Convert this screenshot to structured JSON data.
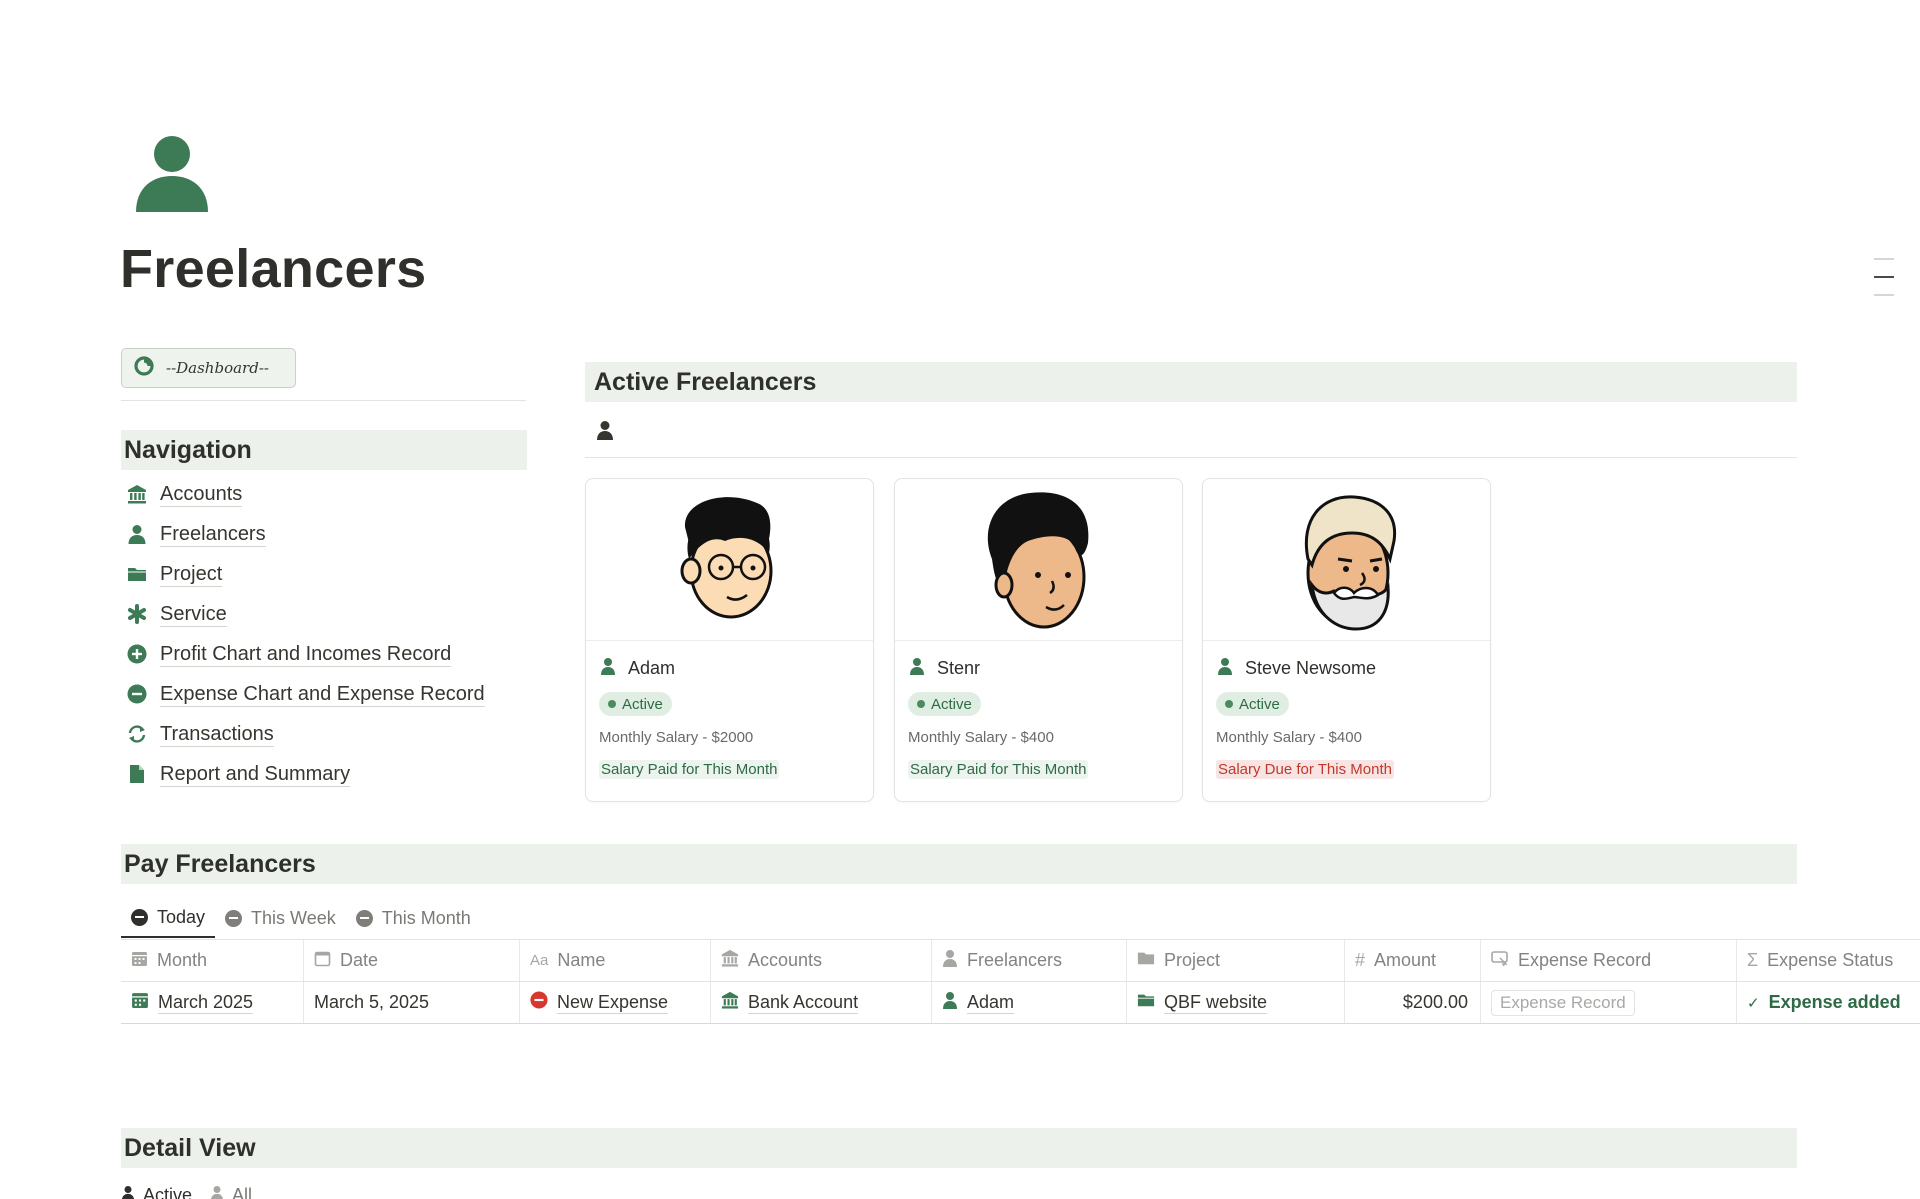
{
  "page": {
    "title": "Freelancers",
    "icon": "person-icon"
  },
  "colors": {
    "accent": "#3d7a56",
    "section_bg": "#edf1ec",
    "due": "#c0392b"
  },
  "dashboard_button": {
    "label": "--Dashboard--",
    "icon": "pie-chart-icon"
  },
  "navigation": {
    "title": "Navigation",
    "items": [
      {
        "label": "Accounts",
        "icon": "bank-icon"
      },
      {
        "label": "Freelancers",
        "icon": "person-icon"
      },
      {
        "label": "Project",
        "icon": "folder-icon"
      },
      {
        "label": "Service",
        "icon": "asterisk-icon"
      },
      {
        "label": "Profit Chart and Incomes Record",
        "icon": "plus-circle-icon"
      },
      {
        "label": "Expense Chart and Expense Record",
        "icon": "minus-circle-icon"
      },
      {
        "label": "Transactions",
        "icon": "refresh-icon"
      },
      {
        "label": "Report and Summary",
        "icon": "document-icon"
      }
    ]
  },
  "active_freelancers": {
    "title": "Active Freelancers",
    "view_icon": "person-icon",
    "cards": [
      {
        "name": "Adam",
        "status": "Active",
        "salary": "Monthly Salary - $2000",
        "payment": "Salary Paid for This Month",
        "payment_state": "paid",
        "avatar": "avatar-adam"
      },
      {
        "name": "Stenr",
        "status": "Active",
        "salary": "Monthly Salary - $400",
        "payment": "Salary Paid for This Month",
        "payment_state": "paid",
        "avatar": "avatar-stenr"
      },
      {
        "name": "Steve Newsome",
        "status": "Active",
        "salary": "Monthly Salary - $400",
        "payment": "Salary Due for This Month",
        "payment_state": "due",
        "avatar": "avatar-steve"
      }
    ]
  },
  "pay_freelancers": {
    "title": "Pay Freelancers",
    "tabs": [
      {
        "label": "Today",
        "active": true
      },
      {
        "label": "This Week",
        "active": false
      },
      {
        "label": "This Month",
        "active": false
      }
    ],
    "columns": [
      {
        "label": "Month",
        "icon": "calendar-icon"
      },
      {
        "label": "Date",
        "icon": "calendar-outline-icon"
      },
      {
        "label": "Name",
        "icon": "text-aa-icon"
      },
      {
        "label": "Accounts",
        "icon": "bank-icon"
      },
      {
        "label": "Freelancers",
        "icon": "person-icon"
      },
      {
        "label": "Project",
        "icon": "folder-icon"
      },
      {
        "label": "Amount",
        "icon": "hash-icon"
      },
      {
        "label": "Expense Record",
        "icon": "button-icon"
      },
      {
        "label": "Expense Status",
        "icon": "sigma-icon"
      }
    ],
    "rows": [
      {
        "month": "March 2025",
        "date": "March 5, 2025",
        "name": "New Expense",
        "account": "Bank Account",
        "freelancer": "Adam",
        "project": "QBF website",
        "amount": "$200.00",
        "expense_record_button": "Expense Record",
        "expense_status": "Expense added"
      }
    ]
  },
  "detail_view": {
    "title": "Detail View",
    "tabs": [
      {
        "label": "Active",
        "active": true
      },
      {
        "label": "All",
        "active": false
      }
    ]
  }
}
